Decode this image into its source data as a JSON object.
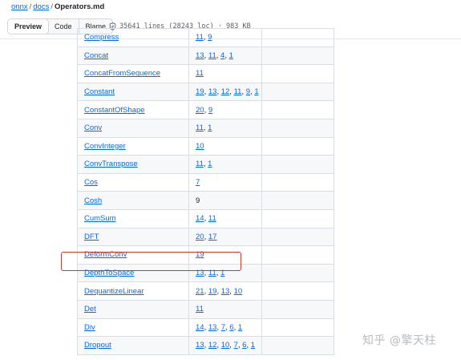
{
  "breadcrumb": {
    "repo": "onnx",
    "folder": "docs",
    "file": "Operators.md",
    "separator": "/"
  },
  "toolbar": {
    "tabs": [
      {
        "label": "Preview",
        "active": true
      },
      {
        "label": "Code",
        "active": false
      },
      {
        "label": "Blame",
        "active": false
      }
    ],
    "file_info": "35641 lines (28243 loc) · 983 KB"
  },
  "operators": [
    {
      "name": "Compress",
      "versions": [
        "11",
        "9"
      ]
    },
    {
      "name": "Concat",
      "versions": [
        "13",
        "11",
        "4",
        "1"
      ]
    },
    {
      "name": "ConcatFromSequence",
      "versions": [
        "11"
      ]
    },
    {
      "name": "Constant",
      "versions": [
        "19",
        "13",
        "12",
        "11",
        "9",
        "1"
      ]
    },
    {
      "name": "ConstantOfShape",
      "versions": [
        "20",
        "9"
      ]
    },
    {
      "name": "Conv",
      "versions": [
        "11",
        "1"
      ]
    },
    {
      "name": "ConvInteger",
      "versions": [
        "10"
      ]
    },
    {
      "name": "ConvTranspose",
      "versions": [
        "11",
        "1"
      ]
    },
    {
      "name": "Cos",
      "versions": [
        "7"
      ]
    },
    {
      "name": "Cosh",
      "versions": [
        "9"
      ],
      "plain": true
    },
    {
      "name": "CumSum",
      "versions": [
        "14",
        "11"
      ]
    },
    {
      "name": "DFT",
      "versions": [
        "20",
        "17"
      ]
    },
    {
      "name": "DeformConv",
      "versions": [
        "19"
      ],
      "highlighted": true
    },
    {
      "name": "DepthToSpace",
      "versions": [
        "13",
        "11",
        "1"
      ]
    },
    {
      "name": "DequantizeLinear",
      "versions": [
        "21",
        "19",
        "13",
        "10"
      ]
    },
    {
      "name": "Det",
      "versions": [
        "11"
      ]
    },
    {
      "name": "Div",
      "versions": [
        "14",
        "13",
        "7",
        "6",
        "1"
      ]
    },
    {
      "name": "Dropout",
      "versions": [
        "13",
        "12",
        "10",
        "7",
        "6",
        "1"
      ]
    }
  ],
  "annotation": {
    "color": "#c8392f"
  },
  "watermark": "知乎 @擎天柱",
  "colors": {
    "link": "#0969da",
    "border": "#d8dee4",
    "stripe": "#f6f8fa"
  }
}
